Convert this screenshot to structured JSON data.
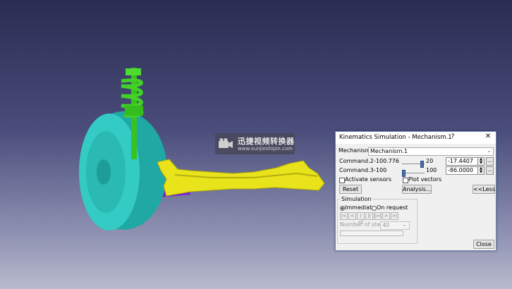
{
  "dialog": {
    "title": "Kinematics Simulation - Mechanism.1",
    "help": "?",
    "close_x": "✕",
    "mechanism_label": "Mechanism:",
    "mechanism_value": "Mechanism.1",
    "commands": [
      {
        "label": "Command.2",
        "min": "-100.776",
        "max": "20",
        "value": "-17.4407",
        "slider_fraction": 0.88
      },
      {
        "label": "Command.3",
        "min": "-100",
        "max": "100",
        "value": "-86.0000",
        "slider_fraction": 0.07
      }
    ],
    "activate_sensors": "Activate sensors",
    "plot_vectors": "Plot vectors",
    "reset": "Reset",
    "analysis": "Analysis...",
    "less": "<<Less",
    "simulation_label": "Simulation",
    "immediate": "Immediate",
    "on_request": "On request",
    "player_buttons": [
      "|<",
      "<",
      "|<|",
      "||",
      "|>|",
      ">",
      ">|"
    ],
    "steps_label": "Number of steps:",
    "steps_value": "40",
    "close_button": "Close",
    "dots": "..."
  },
  "watermark": {
    "title": "迅捷视频转换器",
    "url": "www.xunjieshipin.com"
  },
  "colors": {
    "wheel": "#2ec3bd",
    "spring": "#3fcf24",
    "subframe": "#e4e31a",
    "arm": "#8a2be2"
  }
}
